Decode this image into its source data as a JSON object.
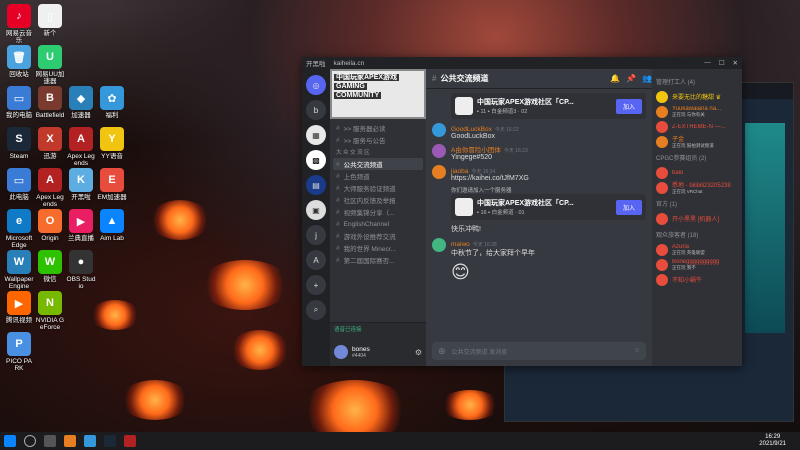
{
  "desktop": {
    "icons": [
      {
        "label": "网易云音乐",
        "color": "#e60026",
        "glyph": "♪",
        "col": 0,
        "row": 0
      },
      {
        "label": "新个",
        "color": "#f0f0f0",
        "glyph": "▯",
        "col": 1,
        "row": 0
      },
      {
        "label": "回收站",
        "color": "#4aa3df",
        "glyph": "🗑",
        "col": 0,
        "row": 1
      },
      {
        "label": "网易UU加速器",
        "color": "#2ecc71",
        "glyph": "U",
        "col": 1,
        "row": 1
      },
      {
        "label": "我的电脑",
        "color": "#3a7bd5",
        "glyph": "▭",
        "col": 0,
        "row": 2
      },
      {
        "label": "Battlefield",
        "color": "#7a3b2e",
        "glyph": "B",
        "col": 1,
        "row": 2
      },
      {
        "label": "加速器",
        "color": "#2980b9",
        "glyph": "◆",
        "col": 2,
        "row": 2
      },
      {
        "label": "福利",
        "color": "#3498db",
        "glyph": "✿",
        "col": 3,
        "row": 2
      },
      {
        "label": "Steam",
        "color": "#1b2838",
        "glyph": "S",
        "col": 0,
        "row": 3
      },
      {
        "label": "迅游",
        "color": "#c0392b",
        "glyph": "X",
        "col": 1,
        "row": 3
      },
      {
        "label": "Apex Legends",
        "color": "#b22222",
        "glyph": "A",
        "col": 2,
        "row": 3
      },
      {
        "label": "YY语音",
        "color": "#f1c40f",
        "glyph": "Y",
        "col": 3,
        "row": 3
      },
      {
        "label": "此电脑",
        "color": "#3a7bd5",
        "glyph": "▭",
        "col": 0,
        "row": 4
      },
      {
        "label": "Apex Legends",
        "color": "#b22222",
        "glyph": "A",
        "col": 1,
        "row": 4
      },
      {
        "label": "开黑啦",
        "color": "#5dade2",
        "glyph": "K",
        "col": 2,
        "row": 4
      },
      {
        "label": "EM加速器",
        "color": "#e74c3c",
        "glyph": "E",
        "col": 3,
        "row": 4
      },
      {
        "label": "Microsoft Edge",
        "color": "#0f7ac6",
        "glyph": "e",
        "col": 0,
        "row": 5
      },
      {
        "label": "Origin",
        "color": "#f56c2d",
        "glyph": "O",
        "col": 1,
        "row": 5
      },
      {
        "label": "兰典直播",
        "color": "#e91e63",
        "glyph": "▶",
        "col": 2,
        "row": 5
      },
      {
        "label": "Aim Lab",
        "color": "#0a84ff",
        "glyph": "▲",
        "col": 3,
        "row": 5
      },
      {
        "label": "Wallpaper Engine",
        "color": "#2980b9",
        "glyph": "W",
        "col": 0,
        "row": 6
      },
      {
        "label": "微信",
        "color": "#2dc100",
        "glyph": "W",
        "col": 1,
        "row": 6
      },
      {
        "label": "OBS Studio",
        "color": "#333333",
        "glyph": "●",
        "col": 2,
        "row": 6
      },
      {
        "label": "腾讯视频",
        "color": "#ff6600",
        "glyph": "▶",
        "col": 0,
        "row": 7
      },
      {
        "label": "NVIDIA GeForce",
        "color": "#76b900",
        "glyph": "N",
        "col": 1,
        "row": 7
      },
      {
        "label": "PICO PARK",
        "color": "#4a90e2",
        "glyph": "P",
        "col": 0,
        "row": 8
      }
    ]
  },
  "taskbar": {
    "time": "16:29",
    "date": "2021/9/21"
  },
  "discord": {
    "app_title": "开黑啦",
    "domain": "kaiheila.cn",
    "server_banner": {
      "line1": "中国玩家APEX游戏",
      "line2": "GAMING",
      "line3": "COMMUNITY"
    },
    "guild_icons": [
      "b",
      "j",
      "A",
      "+"
    ],
    "channels": [
      {
        "label": ">> 服务器必读",
        "type": "text"
      },
      {
        "label": ">> 服务与公告",
        "type": "text"
      },
      {
        "label": "大 众 交 流 区",
        "type": "cat"
      },
      {
        "label": "公共交流频道",
        "type": "text",
        "active": true
      },
      {
        "label": "上色频道",
        "type": "text"
      },
      {
        "label": "大师服务验证频道",
        "type": "text"
      },
      {
        "label": "社区内反馈及举报",
        "type": "text"
      },
      {
        "label": "视频集锦分享（...",
        "type": "text"
      },
      {
        "label": "EnglishChannel",
        "type": "text"
      },
      {
        "label": "游戏外设推荐交流",
        "type": "text"
      },
      {
        "label": "我的世界 Minecr...",
        "type": "text"
      },
      {
        "label": "第二届国际赛否...",
        "type": "text"
      }
    ],
    "voice_status": "语音已连接",
    "user": {
      "name": "bones",
      "tag": "#4404"
    },
    "channel_header": "公共交流频道",
    "messages": [
      {
        "kind": "invite",
        "title": "中国玩家APEX游戏社区「CP...",
        "sub": "▪ 11 ▪ 白金频道3 · 02",
        "join": "加入"
      },
      {
        "kind": "msg",
        "name": "GoodLuckBox",
        "time": "今天 16:22",
        "text": "GoodLuckBox",
        "color": "#3498db"
      },
      {
        "kind": "msg",
        "name": "A由你冒险小团体",
        "time": "今天 16:23",
        "text": "Yingege#520",
        "color": "#9b59b6"
      },
      {
        "kind": "msg",
        "name": "jiaoba",
        "time": "今天 16:24",
        "text": "https://kaihei.co/tJfM7XG",
        "color": "#e67e22"
      },
      {
        "kind": "label",
        "text": "你们邀请加入一个服务器"
      },
      {
        "kind": "invite",
        "title": "中国玩家APEX游戏社区「CP...",
        "sub": "▪ 16 ▪ 白金频道 · 01",
        "join": "加入"
      },
      {
        "kind": "plain",
        "text": "快乐冲鸭!"
      },
      {
        "kind": "msg",
        "name": "maiwo",
        "time": "今天 16:28",
        "text": "中秋节了，给大家拜个早年",
        "color": "#43b581"
      },
      {
        "kind": "emoji",
        "text": "😊"
      }
    ],
    "input_placeholder": "公共交流频道 发消息",
    "member_groups": [
      {
        "title": "管理打工人 (4)",
        "members": [
          {
            "name": "来要无比的糖甜 ♛",
            "status": "",
            "color": "#f1c40f"
          },
          {
            "name": "Yuukawaiana na...",
            "status": "正在玩 与你有关",
            "color": "#e67e22"
          },
          {
            "name": "Z-EXTREME-N —...",
            "status": "",
            "color": "#e74c3c"
          },
          {
            "name": "子金",
            "status": "正在玩 鼓拍测试频道",
            "color": "#e67e22"
          }
        ]
      },
      {
        "title": "CPGC参赛组员 (2)",
        "members": [
          {
            "name": "balo",
            "status": "",
            "color": "#e74c3c"
          },
          {
            "name": "悉地 - bilibili23205238",
            "status": "正在玩 VRChat",
            "color": "#e74c3c"
          }
        ]
      },
      {
        "title": "官方 (1)",
        "members": [
          {
            "name": "开小黑黑 [机器人]",
            "status": "",
            "color": "#e74c3c"
          }
        ]
      },
      {
        "title": "观众旅客者 (18)",
        "members": [
          {
            "name": "Azuria",
            "status": "正在玩 英雄联盟",
            "color": "#e74c3c"
          },
          {
            "name": "Bonegggggggggg",
            "status": "正在玩 我不",
            "color": "#e74c3c"
          },
          {
            "name": "不知小蜗牛",
            "status": "",
            "color": "#e74c3c"
          }
        ]
      }
    ]
  }
}
